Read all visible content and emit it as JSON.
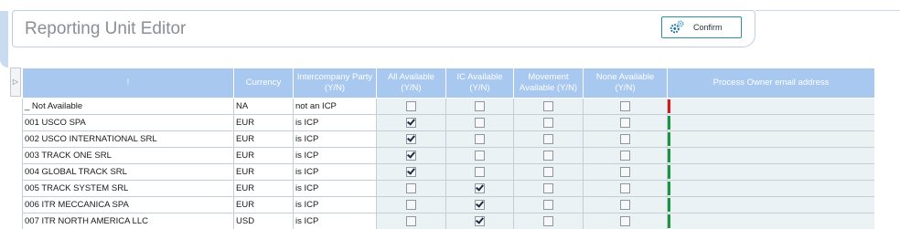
{
  "header": {
    "title": "Reporting Unit Editor",
    "confirm_label": "Confirm",
    "confirm_icon": "gears-icon"
  },
  "grid": {
    "expand_glyph": "▷",
    "columns": [
      "!",
      "Currency",
      "Intercompany Party (Y/N)",
      "All Available (Y/N)",
      "IC Available (Y/N)",
      "Movement Available (Y/N)",
      "None Available (Y/N)",
      "Process Owner email address"
    ],
    "rows": [
      {
        "name": "_ Not Available",
        "currency": "NA",
        "ic_party": "not an ICP",
        "all": false,
        "ic": false,
        "movement": false,
        "none": false,
        "email": "",
        "status_color": "#d7191c"
      },
      {
        "name": "001 USCO SPA",
        "currency": "EUR",
        "ic_party": "is ICP",
        "all": true,
        "ic": false,
        "movement": false,
        "none": false,
        "email": "",
        "status_color": "#1a9641"
      },
      {
        "name": "002 USCO INTERNATIONAL SRL",
        "currency": "EUR",
        "ic_party": "is ICP",
        "all": true,
        "ic": false,
        "movement": false,
        "none": false,
        "email": "",
        "status_color": "#1a9641"
      },
      {
        "name": "003 TRACK ONE SRL",
        "currency": "EUR",
        "ic_party": "is ICP",
        "all": true,
        "ic": false,
        "movement": false,
        "none": false,
        "email": "",
        "status_color": "#1a9641"
      },
      {
        "name": "004 GLOBAL TRACK SRL",
        "currency": "EUR",
        "ic_party": "is ICP",
        "all": true,
        "ic": false,
        "movement": false,
        "none": false,
        "email": "",
        "status_color": "#1a9641"
      },
      {
        "name": "005 TRACK SYSTEM SRL",
        "currency": "EUR",
        "ic_party": "is ICP",
        "all": false,
        "ic": true,
        "movement": false,
        "none": false,
        "email": "",
        "status_color": "#1a9641"
      },
      {
        "name": "006 ITR MECCANICA SPA",
        "currency": "EUR",
        "ic_party": "is ICP",
        "all": false,
        "ic": true,
        "movement": false,
        "none": false,
        "email": "",
        "status_color": "#1a9641"
      },
      {
        "name": "007 ITR NORTH AMERICA LLC",
        "currency": "USD",
        "ic_party": "is ICP",
        "all": false,
        "ic": true,
        "movement": false,
        "none": false,
        "email": "",
        "status_color": "#1a9641"
      }
    ]
  }
}
